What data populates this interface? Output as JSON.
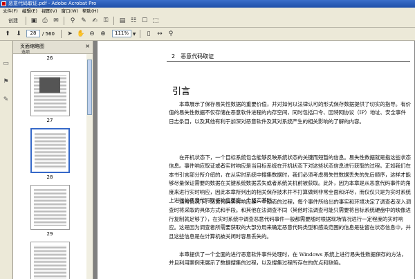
{
  "window": {
    "title": "恶意代码取证.pdf - Adobe Acrobat Pro"
  },
  "menu": [
    "文件(F)",
    "编辑(E)",
    "视图(V)",
    "窗口(W)",
    "帮助(H)"
  ],
  "toolbar": {
    "create_label": "创建",
    "page_current": "28",
    "page_total": "/ 560",
    "zoom": "111%"
  },
  "icons": {
    "prev": "up-arrow-icon",
    "next": "down-arrow-icon",
    "zoom_out": "minus-icon",
    "zoom_in": "plus-icon"
  },
  "thumbnails": {
    "header": "页面缩略图",
    "options": "选项",
    "labels": [
      "26",
      "27",
      "28",
      "29"
    ]
  },
  "page": {
    "running_head": "2　恶意代码取证",
    "chapter_title": "引言",
    "paragraphs": [
      "本章展示了保存易失性数据的重要价值，并对如何以法律认可的形式保存数据提供了切实的指导。有价值的易失性数据不仅存储在恶意软件进程的内存空间，同时包括口令、因特网协议（IP）地址、安全事件日志条目，以及其他有利于加深对恶意软件及其对系统产生的相关影响的了解的内容。",
      "在开机状态下，一个目标系统包含能够反映系统状态的关键而短暂的信息。易失性数据就是指这些状态信息。事件响应取证或者实时响应是当目标系统在开机状态下对这些状态信息进行获取的过程。正如我们在本书引言部分所介绍的，在从实时系统中搜集数据时，我们必须考虑易失性数据丢失的先后顺序，这样才能够尽量保证需要的数据在关键系统数据丢失或者系统关机前被获取。此外，因为本章是从恶意代码事件的角度来进行实时响应，因此本章所列出的相关保存技术并不打算做到非常全面和详尽，而仅仅只是为实时系统上进行的恶意代码取证响应奠定一个坚实基础。",
      "通常情况下，恶意代码实时响应是一个动态的过程，每个事件所给出的事实和环境决定了调查者深入调查时将采取的具体方式和手段。和其他在法调查不同（其他时法调查可能只需要将目标系统硬盘中的映像进行复制就足够了），在实时系统中调查恶意代码事件一般都需要随时根据现场情况进行一定程度的实时响应。这是因为调查者所需要获取的大部分用来确定恶意代码类型和感染范围的信息是驻留在状态信息中，并且这些信息是在计算机被关闭时容易丢失的。",
      "本章提供了一个全面的进行恶意软件事件处理时，在 Windows 系统上进行易失性数据保存的方法，并且利用案例来展示了数据搜集的过程，以及搜集过程所存在的优点和缺陷。"
    ]
  }
}
